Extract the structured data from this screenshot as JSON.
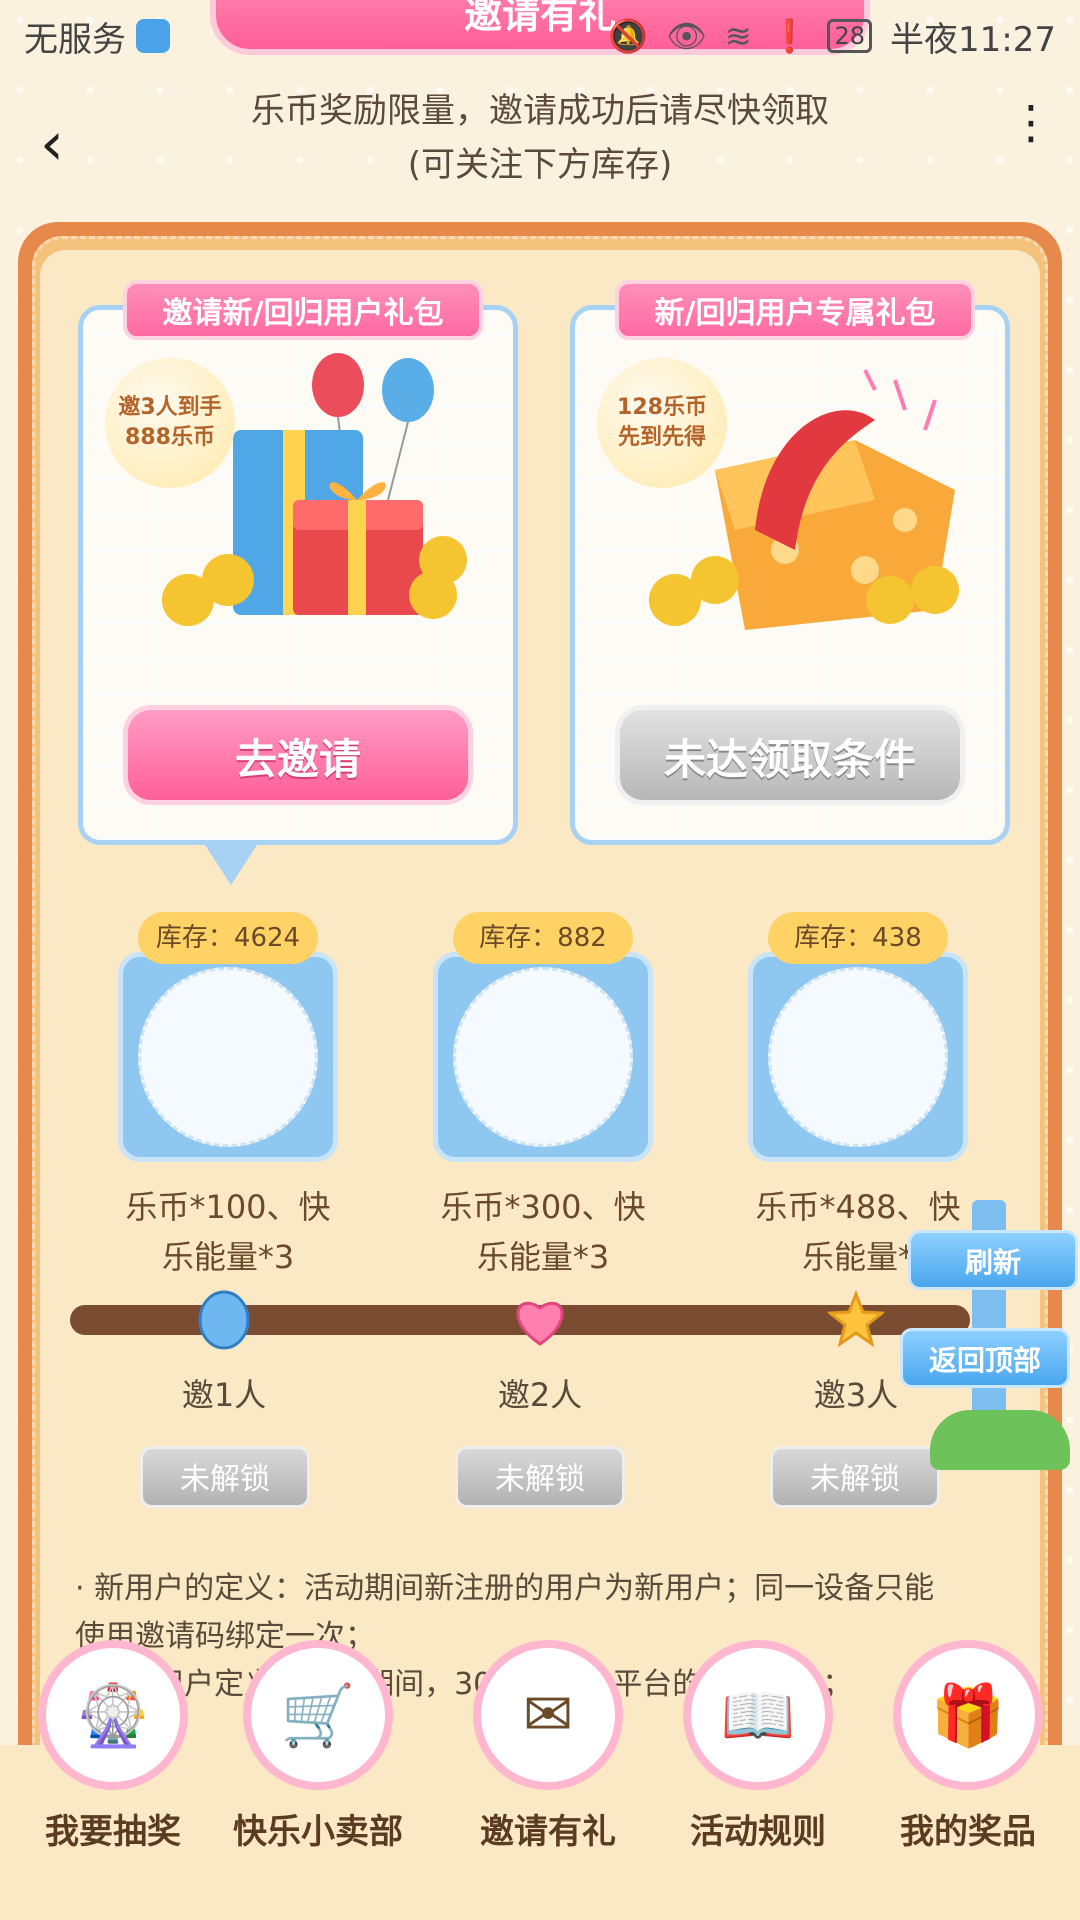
{
  "status_bar": {
    "carrier": "无服务",
    "battery": "28",
    "time": "半夜11:27"
  },
  "top_banner": {
    "title": "邀请有礼"
  },
  "notice": {
    "line1": "乐币奖励限量，邀请成功后请尽快领取",
    "line2": "(可关注下方库存)"
  },
  "gift_cards": [
    {
      "tag": "邀请新/回归用户礼包",
      "bubble_line1": "邀3人到手",
      "bubble_line2": "888乐币",
      "button": "去邀请"
    },
    {
      "tag": "新/回归用户专属礼包",
      "bubble_line1": "128乐币",
      "bubble_line2": "先到先得",
      "button": "未达领取条件"
    }
  ],
  "tiers": [
    {
      "stock": "库存：4624",
      "desc1": "乐币*100、快",
      "desc2": "乐能量*3",
      "node": "邀1人",
      "lock": "未解锁"
    },
    {
      "stock": "库存：882",
      "desc1": "乐币*300、快",
      "desc2": "乐能量*3",
      "node": "邀2人",
      "lock": "未解锁"
    },
    {
      "stock": "库存：438",
      "desc1": "乐币*488、快",
      "desc2": "乐能量*",
      "node": "邀3人",
      "lock": "未解锁"
    }
  ],
  "rules": {
    "line1": "· 新用户的定义：活动期间新注册的用户为新用户；同一设备只能",
    "line2": "使用邀请码绑定一次；",
    "line3": "· 回归用户定义：活动期间，30天未登录平台的回归用户；"
  },
  "signpost": {
    "refresh": "刷新",
    "back_to_top": "返回顶部"
  },
  "bottom_nav": [
    {
      "label": "我要抽奖",
      "icon": "wheel-icon"
    },
    {
      "label": "快乐小卖部",
      "icon": "cart-icon"
    },
    {
      "label": "邀请有礼",
      "icon": "invite-icon"
    },
    {
      "label": "活动规则",
      "icon": "book-icon"
    },
    {
      "label": "我的奖品",
      "icon": "gift-icon"
    }
  ],
  "colors": {
    "accent_pink": "#ff5f97",
    "frame_orange": "#e7894a",
    "track_brown": "#7a4d33",
    "sky_blue": "#8ec8f0"
  }
}
